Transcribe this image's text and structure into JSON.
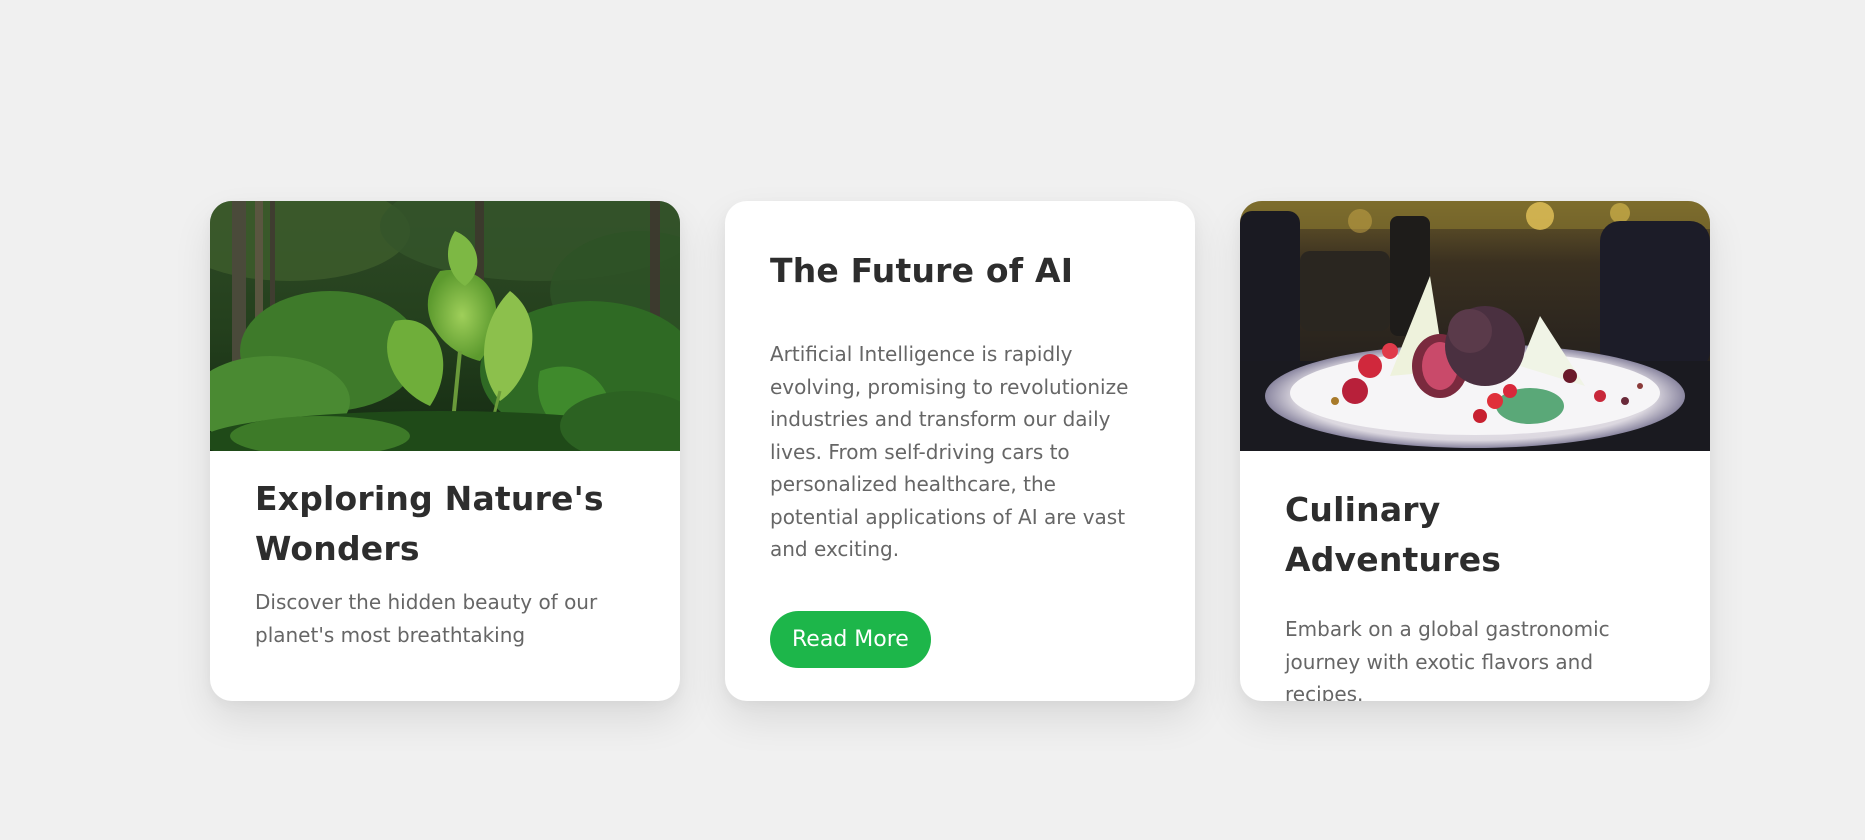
{
  "cards": [
    {
      "title": "Exploring Nature's Wonders",
      "text": "Discover the hidden beauty of our planet's most breathtaking",
      "image": "jungle-photo"
    },
    {
      "title": "The Future of AI",
      "text": "Artificial Intelligence is rapidly evolving, promising to revolutionize industries and transform our daily lives. From self-driving cars to personalized healthcare, the potential applications of AI are vast and exciting.",
      "button_label": "Read More"
    },
    {
      "title": "Culinary Adventures",
      "text": "Embark on a global gastronomic journey with exotic flavors and recipes.",
      "image": "dessert-plate-photo"
    }
  ],
  "colors": {
    "background": "#f0f0f0",
    "card": "#ffffff",
    "accent": "#1db64a",
    "title": "#2d2d2d",
    "text": "#666666"
  }
}
